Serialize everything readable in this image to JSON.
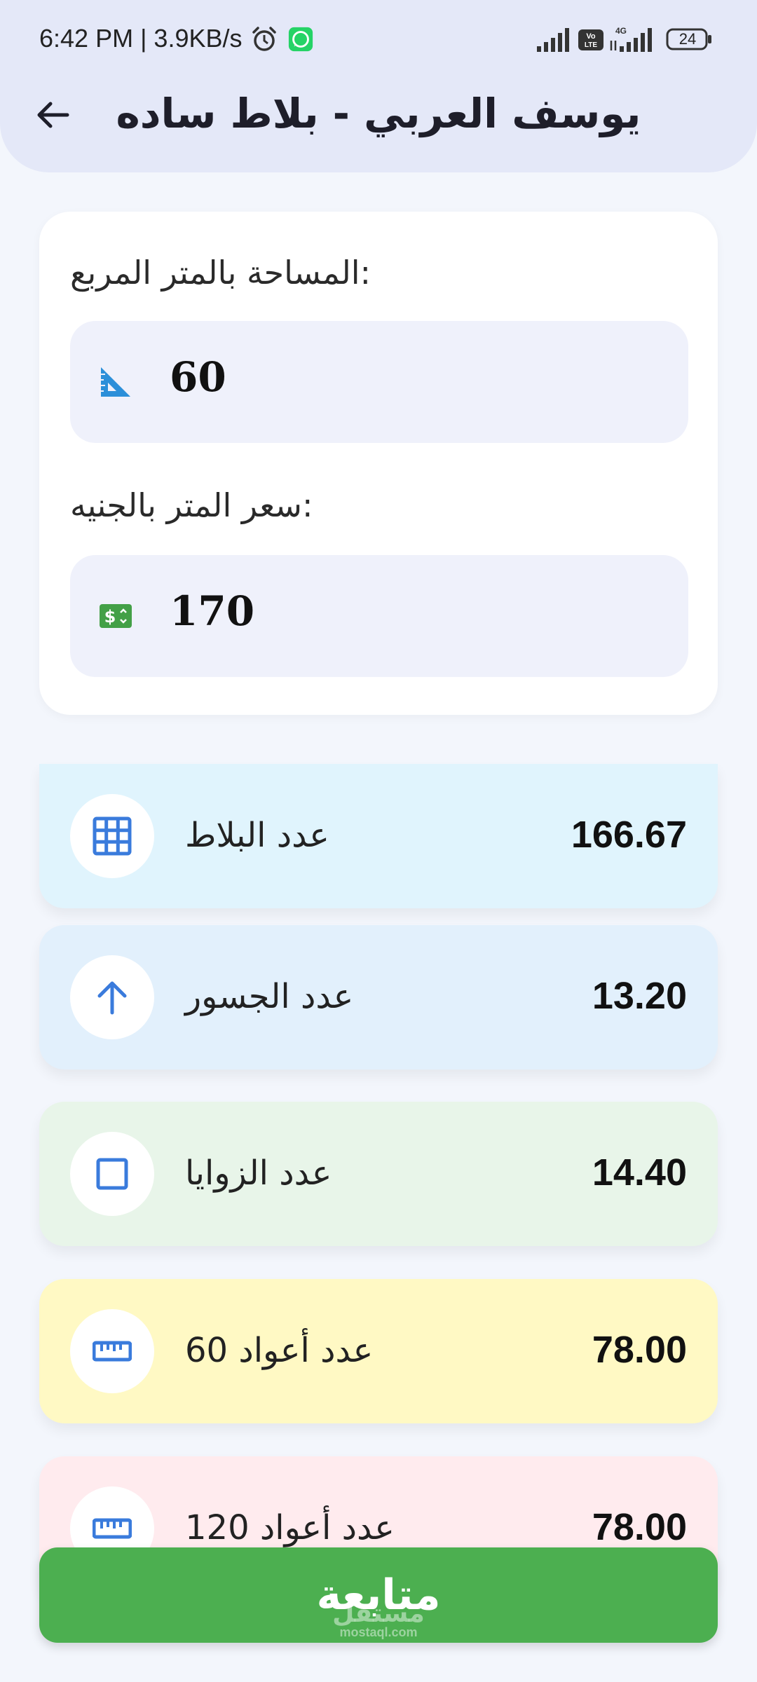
{
  "status_bar": {
    "time_speed": "6:42 PM | 3.9KB/s",
    "volte": "Vo LTE",
    "network": "4G",
    "battery": "24"
  },
  "header": {
    "title": "يوسف العربي - بلاط ساده"
  },
  "inputs": {
    "area_label": "المساحة بالمتر المربع:",
    "area_value": "60",
    "price_label": "سعر المتر بالجنيه:",
    "price_value": "170"
  },
  "results": [
    {
      "label": "عدد البلاط",
      "value": "166.67",
      "icon": "grid-icon",
      "color": "#e0f4fd"
    },
    {
      "label": "عدد الجسور",
      "value": "13.20",
      "icon": "arrow-up-icon",
      "color": "#e2f0fc"
    },
    {
      "label": "عدد الزوايا",
      "value": "14.40",
      "icon": "square-icon",
      "color": "#e8f5e9"
    },
    {
      "label": "عدد أعواد 60",
      "value": "78.00",
      "icon": "ruler-icon",
      "color": "#fff9c4"
    },
    {
      "label": "عدد أعواد 120",
      "value": "78.00",
      "icon": "ruler-icon",
      "color": "#ffebee"
    }
  ],
  "footer": {
    "continue_label": "متابعة",
    "watermark_ar": "مستقل",
    "watermark_en": "mostaql.com"
  },
  "colors": {
    "accent_green": "#4caf50",
    "icon_blue": "#3a7bdc",
    "header_bg": "#e4e8f8"
  }
}
